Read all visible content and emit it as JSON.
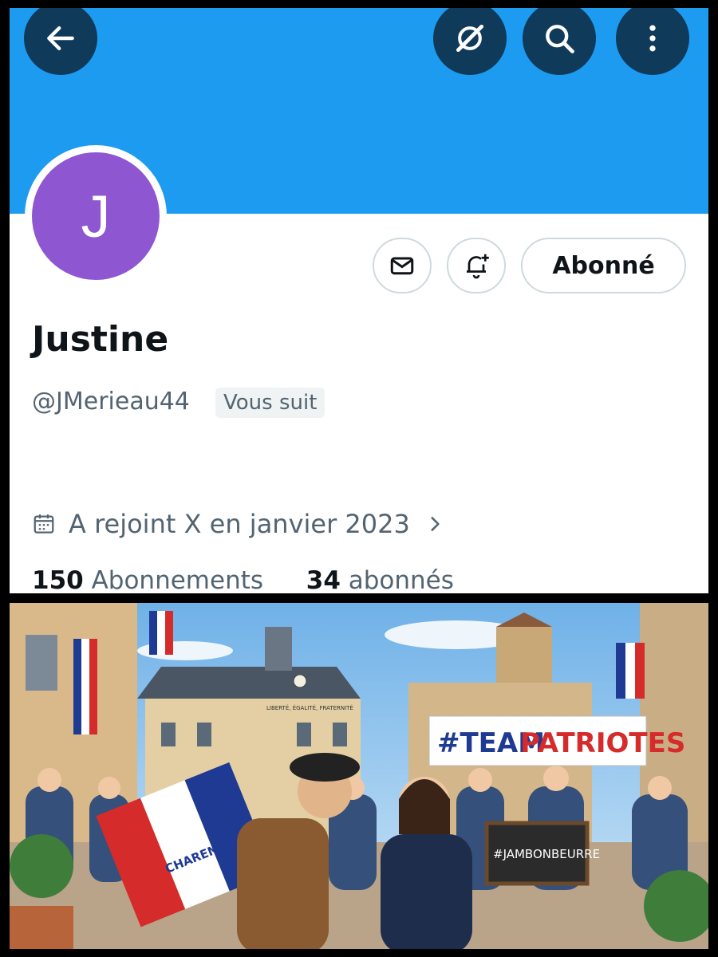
{
  "profile": {
    "initial": "J",
    "name": "Justine",
    "handle": "@JMerieau44",
    "follows_you_badge": "Vous suit",
    "joined": "A rejoint X en janvier 2023",
    "following_count": "150",
    "following_label": "Abonnements",
    "followers_count": "34",
    "followers_label": "abonnés",
    "follow_button_label": "Abonné"
  },
  "illustration": {
    "building_inscription": "LIBERTÉ, ÉGALITÉ, FRATERNITÉ",
    "banner_text_left": "#TEAM",
    "banner_text_right": "PATRIOTES",
    "flag_text": "CHARENTE",
    "chalkboard_text": "#JAMBONBEURRE"
  },
  "colors": {
    "banner_blue": "#1d9bf0",
    "avatar_purple": "#8e57d1",
    "header_button": "#0f3a5a",
    "text_primary": "#0f1419",
    "text_secondary": "#536471"
  }
}
